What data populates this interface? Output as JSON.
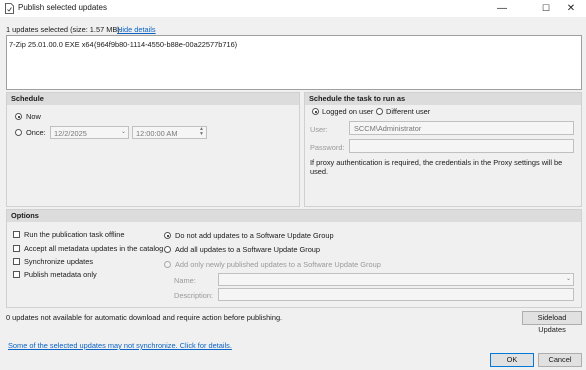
{
  "window": {
    "title": "Publish selected updates",
    "minimize_glyph": "—",
    "maximize_glyph": "☐",
    "close_glyph": "✕"
  },
  "summary": {
    "text": "1 updates selected (size: 1.57 MB).",
    "hide_details": "Hide details"
  },
  "update_list": {
    "items": [
      {
        "name": "7-Zip 25.01.00.0 EXE x64",
        "guid": "(964f9b80-1114-4550-b88e-00a22577b716)"
      }
    ]
  },
  "schedule": {
    "header": "Schedule",
    "now_label": "Now",
    "once_label": "Once:",
    "date_value": "12/2/2025",
    "time_value": "12:00:00 AM"
  },
  "run_as": {
    "header": "Schedule the task to run as",
    "logged_on_label": "Logged on user",
    "different_user_label": "Different user",
    "user_label": "User:",
    "user_value": "SCCM\\Administrator",
    "password_label": "Password:",
    "password_value": "",
    "proxy_note": "If proxy authentication is required, the credentials in the Proxy settings will be used."
  },
  "options": {
    "header": "Options",
    "checkboxes": [
      "Run the publication task offline",
      "Accept all metadata updates in the catalog",
      "Synchronize updates",
      "Publish metadata only"
    ],
    "radios": [
      "Do not add updates to a Software Update Group",
      "Add all updates to a Software Update Group",
      "Add only newly published updates to a Software Update Group"
    ],
    "name_label": "Name:",
    "description_label": "Description:"
  },
  "footer": {
    "status": "0 updates not available for automatic download and require action before publishing.",
    "sideload_label": "Sideload Updates",
    "warning_link": "Some of the selected updates may not synchronize. Click for details.",
    "ok_label": "OK",
    "cancel_label": "Cancel"
  }
}
